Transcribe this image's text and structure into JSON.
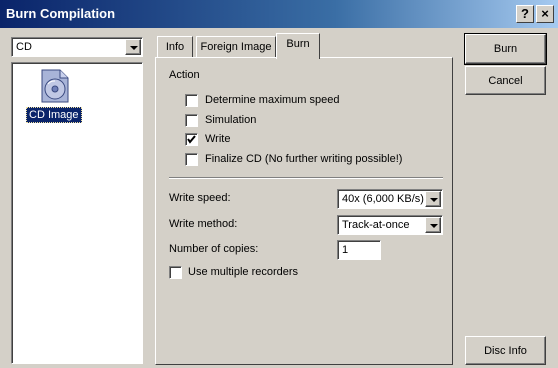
{
  "window": {
    "title": "Burn Compilation",
    "help_label": "?",
    "close_label": "×"
  },
  "left": {
    "drive_select": "CD",
    "item_label": "CD Image",
    "item_icon": "cd-image-icon"
  },
  "tabs": [
    {
      "label": "Info",
      "active": false
    },
    {
      "label": "Foreign Image",
      "active": false
    },
    {
      "label": "Burn",
      "active": true
    }
  ],
  "burn": {
    "action_label": "Action",
    "options": [
      {
        "label": "Determine maximum speed",
        "checked": false,
        "enabled": true
      },
      {
        "label": "Simulation",
        "checked": false,
        "enabled": true
      },
      {
        "label": "Write",
        "checked": true,
        "enabled": true
      },
      {
        "label": "Finalize CD (No further writing possible!)",
        "checked": false,
        "enabled": true
      }
    ],
    "write_speed_label": "Write speed:",
    "write_speed_value": "40x (6,000 KB/s)",
    "write_method_label": "Write method:",
    "write_method_value": "Track-at-once",
    "copies_label": "Number of copies:",
    "copies_value": "1",
    "multi_recorders_label": "Use multiple recorders",
    "multi_recorders_checked": false
  },
  "buttons": {
    "burn": "Burn",
    "cancel": "Cancel",
    "disc_info": "Disc Info"
  },
  "colors": {
    "face": "#d4d0c8",
    "title_start": "#0a246a",
    "title_end": "#a6caf0",
    "selection": "#0a246a"
  }
}
